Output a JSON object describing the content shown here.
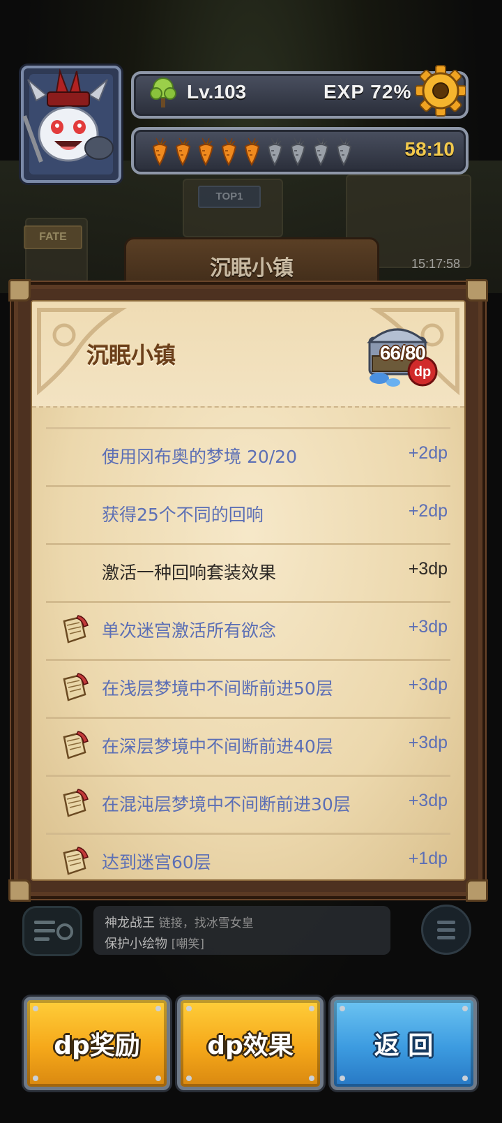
{
  "hud": {
    "level": "Lv.103",
    "exp": "EXP  72%",
    "exp_percent": 72,
    "energy_timer": "58:10",
    "carrots_total": 9,
    "carrots_filled": 5,
    "icons": [
      "tree-icon",
      "gear-icon",
      "carrot-icon"
    ]
  },
  "scene": {
    "location_title": "沉眠小镇",
    "fate_sign": "FATE",
    "top_sign": "TOP1",
    "timer": "15:17:58"
  },
  "panel": {
    "title": "沉眠小镇",
    "dp_count": "66/80",
    "dp_badge": "dp",
    "tasks": [
      {
        "text": "使用冈布奥的梦境 20/20",
        "reward": "+2dp",
        "status": "done",
        "scroll": false
      },
      {
        "text": "获得25个不同的回响",
        "reward": "+2dp",
        "status": "done",
        "scroll": false
      },
      {
        "text": "激活一种回响套装效果",
        "reward": "+3dp",
        "status": "pending",
        "scroll": false
      },
      {
        "text": "单次迷宫激活所有欲念",
        "reward": "+3dp",
        "status": "done",
        "scroll": true
      },
      {
        "text": "在浅层梦境中不间断前进50层",
        "reward": "+3dp",
        "status": "done",
        "scroll": true
      },
      {
        "text": "在深层梦境中不间断前进40层",
        "reward": "+3dp",
        "status": "done",
        "scroll": true
      },
      {
        "text": "在混沌层梦境中不间断前进30层",
        "reward": "+3dp",
        "status": "done",
        "scroll": true
      },
      {
        "text": "达到迷宫60层",
        "reward": "+1dp",
        "status": "done",
        "scroll": true
      }
    ]
  },
  "chat": {
    "sender": "神龙战王",
    "message1": "链接，找冰雪女皇",
    "message2": "保护小绘物",
    "emote": "[嘲笑]"
  },
  "buttons": {
    "dp_reward": "dp奖励",
    "dp_effect": "dp效果",
    "back": "返 回"
  },
  "colors": {
    "done_text": "#5c6fb5",
    "pending_text": "#2e2a26",
    "yellow_button": "#f5a81a",
    "blue_button": "#3c9be0",
    "timer": "#f2c94c"
  }
}
